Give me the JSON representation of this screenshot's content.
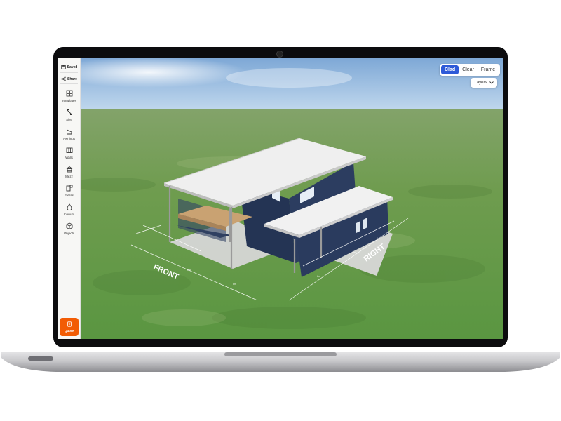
{
  "sidebar": {
    "saved": "Saved",
    "share": "Share",
    "tools": [
      {
        "label": "Templates",
        "icon": "grid-icon"
      },
      {
        "label": "Size",
        "icon": "resize-icon"
      },
      {
        "label": "Awnings",
        "icon": "awning-icon"
      },
      {
        "label": "Walls",
        "icon": "walls-icon"
      },
      {
        "label": "Mezz",
        "icon": "mezzanine-icon"
      },
      {
        "label": "Extras",
        "icon": "extras-icon"
      },
      {
        "label": "Colours",
        "icon": "droplet-icon"
      },
      {
        "label": "Objects",
        "icon": "cube-icon"
      }
    ],
    "quote": "Quote"
  },
  "view_modes": [
    "Clad",
    "Clear",
    "Frame"
  ],
  "active_view": "Clad",
  "layers_label": "Layers",
  "scene": {
    "front_label": "FRONT",
    "right_label": "RIGHT"
  },
  "colors": {
    "accent": "#2e5ad8",
    "quote": "#f25c05",
    "wall": "#2b3a5c",
    "roof": "#eeeeee",
    "deck": "#c8a373"
  }
}
